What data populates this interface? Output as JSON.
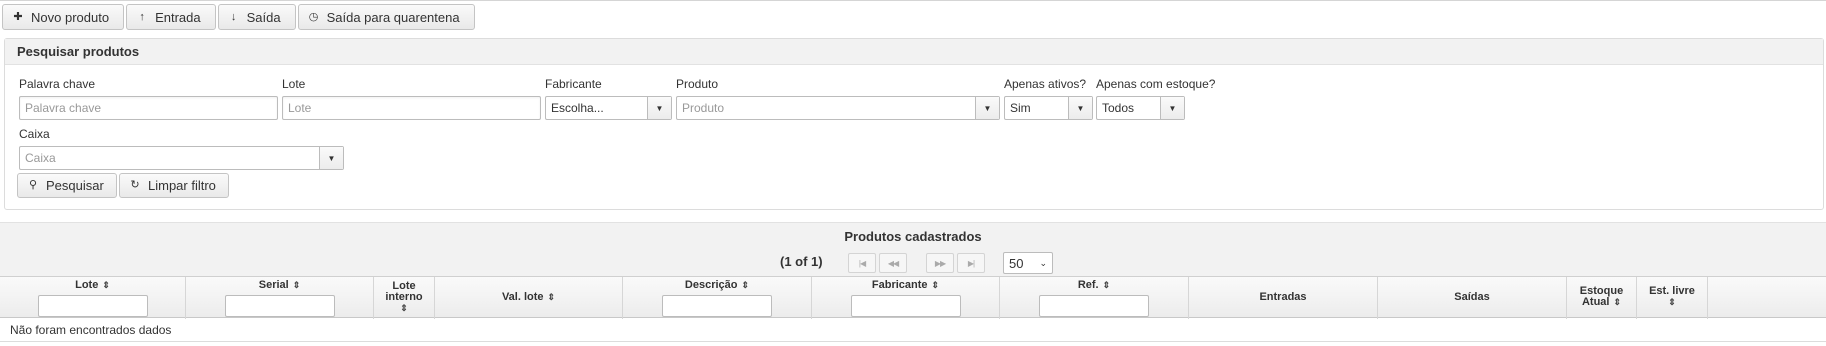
{
  "toolbar": {
    "new_product": "Novo produto",
    "entry": "Entrada",
    "exit": "Saída",
    "quarantine_exit": "Saída para quarentena"
  },
  "search": {
    "title": "Pesquisar produtos",
    "keyword_label": "Palavra chave",
    "keyword_placeholder": "Palavra chave",
    "lot_label": "Lote",
    "lot_placeholder": "Lote",
    "manufacturer_label": "Fabricante",
    "manufacturer_value": "Escolha...",
    "product_label": "Produto",
    "product_placeholder": "Produto",
    "active_only_label": "Apenas ativos?",
    "active_only_value": "Sim",
    "with_stock_label": "Apenas com estoque?",
    "with_stock_value": "Todos",
    "box_label": "Caixa",
    "box_placeholder": "Caixa",
    "search_button": "Pesquisar",
    "clear_button": "Limpar filtro"
  },
  "results": {
    "title": "Produtos cadastrados",
    "page_info": "(1 of 1)",
    "rows_per_page": "50",
    "columns": {
      "lot": "Lote",
      "serial": "Serial",
      "internal_lot_1": "Lote",
      "internal_lot_2": "interno",
      "lot_value": "Val. lote",
      "description": "Descrição",
      "manufacturer": "Fabricante",
      "ref": "Ref.",
      "entries": "Entradas",
      "exits": "Saídas",
      "current_stock_1": "Estoque",
      "current_stock_2": "Atual",
      "free_stock": "Est. livre"
    },
    "empty_message": "Não foram encontrados dados"
  },
  "icons": {
    "plus": "plus-icon",
    "arrow_up": "arrow-up-icon",
    "arrow_down": "arrow-down-icon",
    "clock": "clock-icon",
    "search": "search-icon",
    "refresh": "refresh-icon",
    "sort": "sort-icon",
    "dropdown": "chevron-down-icon"
  }
}
